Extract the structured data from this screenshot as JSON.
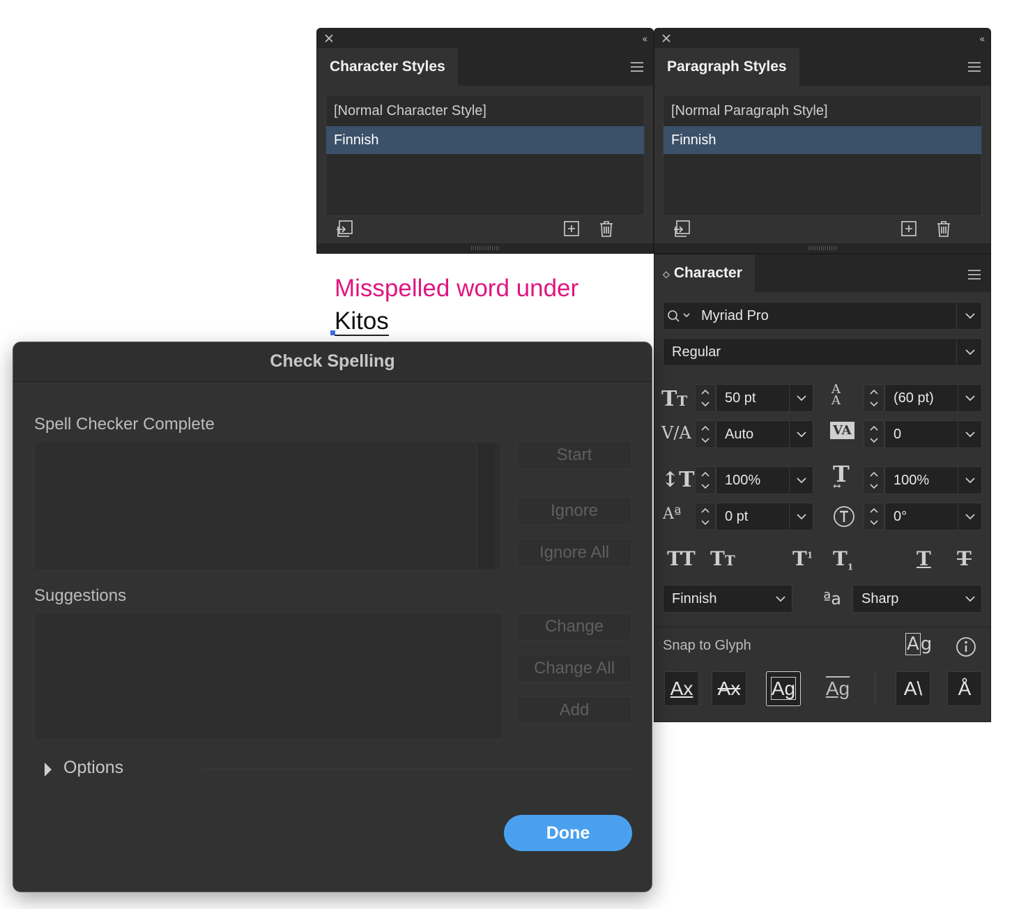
{
  "character_styles": {
    "tab_label": "Character Styles",
    "items": [
      {
        "label": "[Normal Character Style]",
        "selected": false
      },
      {
        "label": "Finnish",
        "selected": true
      }
    ]
  },
  "paragraph_styles": {
    "tab_label": "Paragraph Styles",
    "items": [
      {
        "label": "[Normal Paragraph Style]",
        "selected": false
      },
      {
        "label": "Finnish",
        "selected": true
      }
    ]
  },
  "canvas_text": {
    "line1": "Misspelled word under",
    "line2": "Kitos",
    "line1_color": "#e0157f"
  },
  "character": {
    "tab_label": "Character",
    "font_family": "Myriad Pro",
    "font_style": "Regular",
    "font_size": "50 pt",
    "leading": "(60 pt)",
    "kerning": "Auto",
    "tracking": "0",
    "vertical_scale": "100%",
    "horizontal_scale": "100%",
    "baseline_shift": "0 pt",
    "rotation": "0°",
    "language": "Finnish",
    "anti_aliasing": "Sharp",
    "snap_to_glyph_label": "Snap to Glyph"
  },
  "dialog": {
    "title": "Check Spelling",
    "status_label": "Spell Checker Complete",
    "suggestions_label": "Suggestions",
    "options_label": "Options",
    "buttons": {
      "start": "Start",
      "ignore": "Ignore",
      "ignore_all": "Ignore All",
      "change": "Change",
      "change_all": "Change All",
      "add": "Add",
      "done": "Done"
    },
    "accent_color": "#4aa0ef"
  }
}
